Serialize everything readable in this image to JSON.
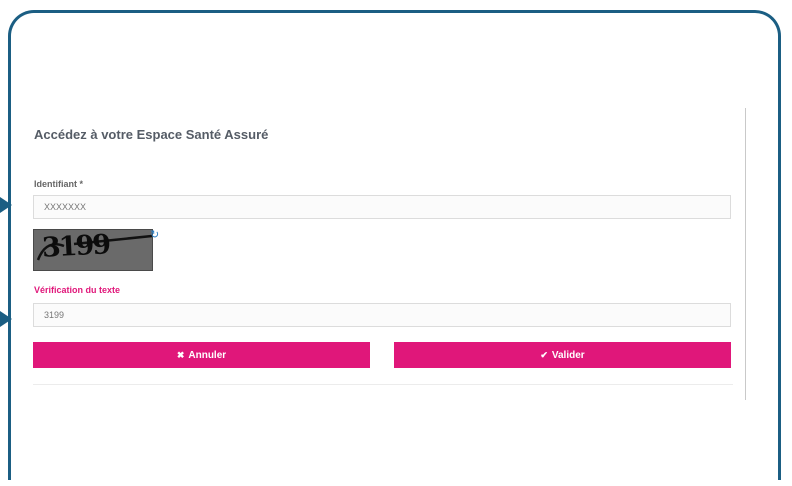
{
  "title": "Accédez à votre Espace Santé Assuré",
  "identifier": {
    "label": "Identifiant *",
    "value": "XXXXXXX"
  },
  "captcha": {
    "image_text": "3199",
    "refresh_icon": "refresh-icon"
  },
  "verification": {
    "label": "Vérification du texte",
    "value": "3199"
  },
  "buttons": {
    "cancel_icon": "✖",
    "cancel_label": "Annuler",
    "submit_icon": "✔",
    "submit_label": "Valider"
  },
  "colors": {
    "accent": "#e0177a",
    "frame": "#1b5e83",
    "refresh": "#2d7fc4"
  }
}
